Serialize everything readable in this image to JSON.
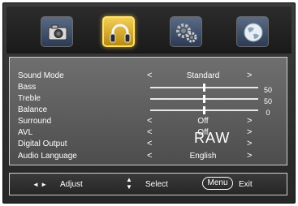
{
  "tabs": [
    {
      "name": "picture-icon",
      "active": false
    },
    {
      "name": "audio-headphones-icon",
      "active": true
    },
    {
      "name": "settings-gear-icon",
      "active": false
    },
    {
      "name": "globe-icon",
      "active": false
    }
  ],
  "menu": {
    "rows": [
      {
        "label": "Sound Mode",
        "type": "select",
        "value": "Standard",
        "left": "<",
        "right": ">"
      },
      {
        "label": "Bass",
        "type": "slider",
        "value": "50",
        "level": 0.5
      },
      {
        "label": "Treble",
        "type": "slider",
        "value": "50",
        "level": 0.5
      },
      {
        "label": "Balance",
        "type": "slider",
        "value": "0",
        "level": 0.5
      },
      {
        "label": "Surround",
        "type": "select",
        "value": "Off",
        "left": "<",
        "right": ">"
      },
      {
        "label": "AVL",
        "type": "select",
        "value": "Off",
        "left": "<",
        "right": ">"
      },
      {
        "label": "Digital Output",
        "type": "select",
        "value": "",
        "left": "<",
        "right": ">"
      },
      {
        "label": "Audio Language",
        "type": "select",
        "value": "English",
        "left": "<",
        "right": ">"
      }
    ]
  },
  "overlay": {
    "watermark": "RAW"
  },
  "footer": {
    "adjust_arrows": "◄ ►",
    "adjust_label": "Adjust",
    "select_label": "Select",
    "menu_key": "Menu",
    "exit_label": "Exit"
  },
  "colors": {
    "active_tab": "#e8b830",
    "panel": "#5e5e5e",
    "background": "#2e2e2e"
  }
}
